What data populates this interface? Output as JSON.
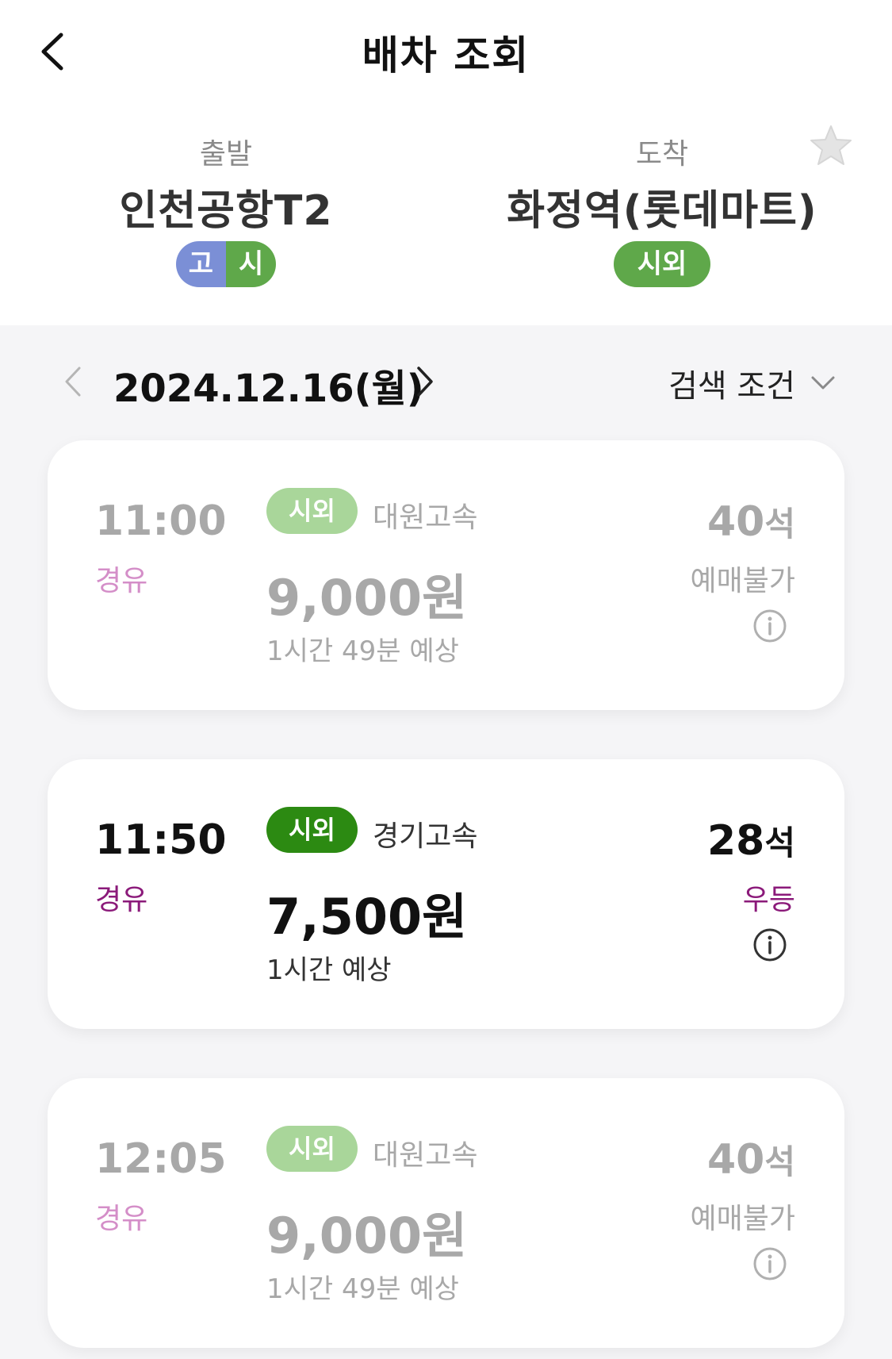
{
  "header": {
    "title": "배차 조회",
    "back_icon": "chevron-left-icon"
  },
  "route": {
    "departure": {
      "label": "출발",
      "name": "인천공항T2",
      "badges": [
        "고",
        "시"
      ]
    },
    "arrival": {
      "label": "도착",
      "name": "화정역(롯데마트)",
      "badge": "시외"
    },
    "favorite_icon": "star-icon"
  },
  "date_bar": {
    "date": "2024.12.16(월)",
    "filter_label": "검색 조건"
  },
  "schedules": [
    {
      "time": "11:00",
      "via": "경유",
      "type": "시외",
      "company": "대원고속",
      "price": "9,000원",
      "duration": "1시간 49분 예상",
      "seats": "40",
      "seat_unit": "석",
      "status": "예매불가",
      "available": false
    },
    {
      "time": "11:50",
      "via": "경유",
      "type": "시외",
      "company": "경기고속",
      "price": "7,500원",
      "duration": "1시간 예상",
      "seats": "28",
      "seat_unit": "석",
      "status": "우등",
      "available": true
    },
    {
      "time": "12:05",
      "via": "경유",
      "type": "시외",
      "company": "대원고속",
      "price": "9,000원",
      "duration": "1시간 49분 예상",
      "seats": "40",
      "seat_unit": "석",
      "status": "예매불가",
      "available": false
    }
  ],
  "colors": {
    "express_badge": "#7b8fd6",
    "intercity_badge": "#5fa84a",
    "intercity_active": "#2c8a12",
    "intercity_dim": "#a9d69a",
    "via_active": "#8b1a7a",
    "background_gray": "#f5f5f7"
  }
}
